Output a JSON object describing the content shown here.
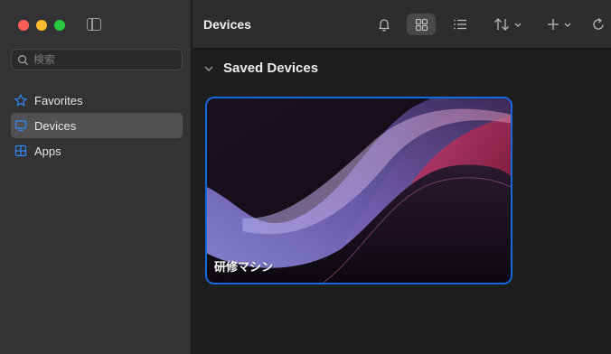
{
  "window": {
    "title": "Devices"
  },
  "sidebar": {
    "search_placeholder": "検索",
    "items": [
      {
        "label": "Favorites",
        "icon": "star-icon",
        "active": false
      },
      {
        "label": "Devices",
        "icon": "monitor-icon",
        "active": true
      },
      {
        "label": "Apps",
        "icon": "grid-icon",
        "active": false
      }
    ]
  },
  "toolbar": {
    "icons": [
      "bell-icon",
      "grid-view-icon",
      "list-view-icon",
      "sort-icon",
      "add-icon",
      "refresh-icon"
    ]
  },
  "main": {
    "section_title": "Saved Devices",
    "devices": [
      {
        "name": "研修マシン",
        "selected": true
      }
    ]
  },
  "colors": {
    "accent": "#1769e0",
    "sidebar_bg": "#333335",
    "content_bg": "#1e1e1e",
    "icon_blue": "#2f8cff"
  }
}
